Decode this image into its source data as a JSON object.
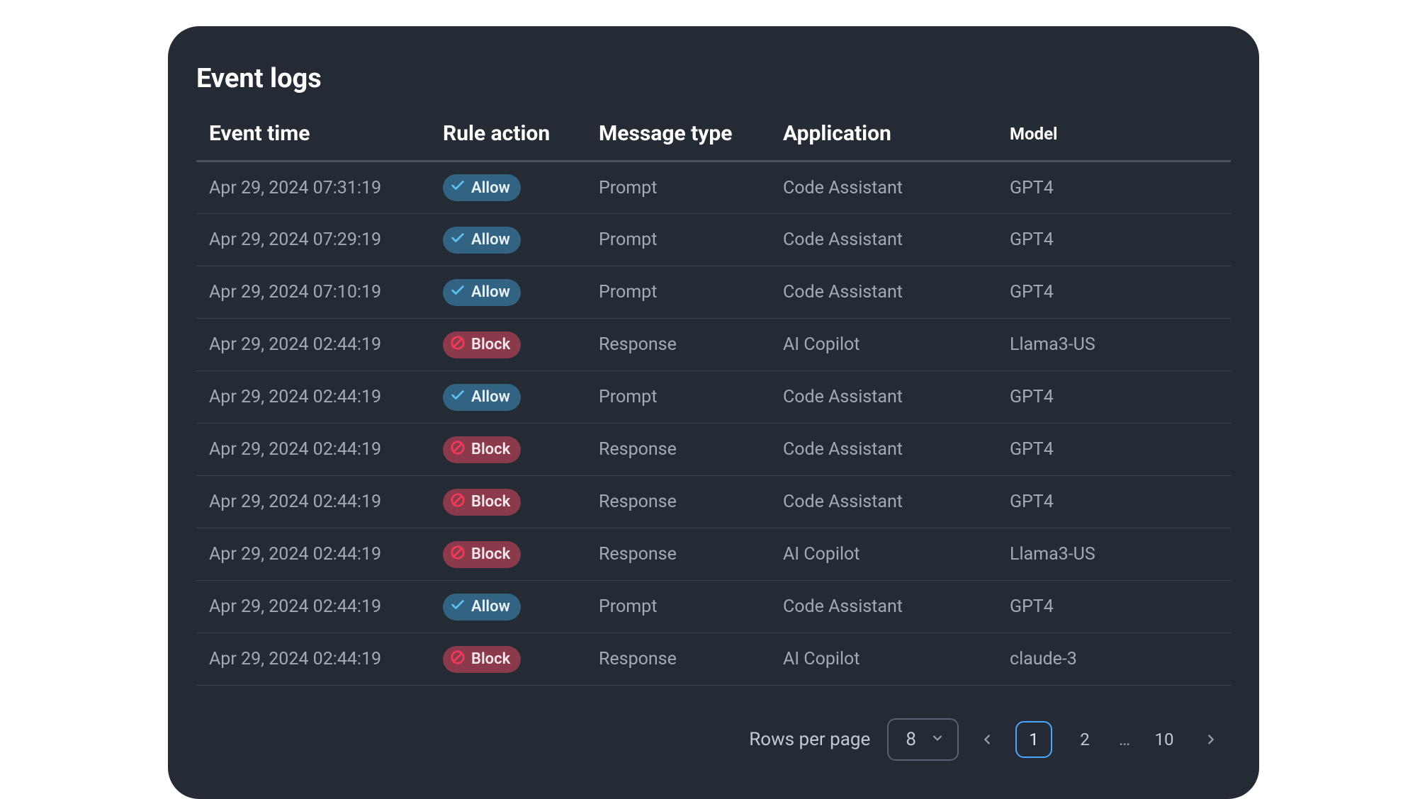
{
  "title": "Event logs",
  "columns": {
    "time": "Event time",
    "action": "Rule action",
    "msgtype": "Message type",
    "app": "Application",
    "model": "Model"
  },
  "badge_labels": {
    "allow": "Allow",
    "block": "Block"
  },
  "rows": [
    {
      "time": "Apr 29, 2024 07:31:19",
      "action": "allow",
      "msgtype": "Prompt",
      "app": "Code Assistant",
      "model": "GPT4"
    },
    {
      "time": "Apr 29, 2024 07:29:19",
      "action": "allow",
      "msgtype": "Prompt",
      "app": "Code Assistant",
      "model": "GPT4"
    },
    {
      "time": "Apr 29, 2024 07:10:19",
      "action": "allow",
      "msgtype": "Prompt",
      "app": "Code Assistant",
      "model": "GPT4"
    },
    {
      "time": "Apr 29, 2024 02:44:19",
      "action": "block",
      "msgtype": "Response",
      "app": "AI Copilot",
      "model": "Llama3-US"
    },
    {
      "time": "Apr 29, 2024 02:44:19",
      "action": "allow",
      "msgtype": "Prompt",
      "app": "Code Assistant",
      "model": "GPT4"
    },
    {
      "time": "Apr 29, 2024 02:44:19",
      "action": "block",
      "msgtype": "Response",
      "app": "Code Assistant",
      "model": "GPT4"
    },
    {
      "time": "Apr 29, 2024 02:44:19",
      "action": "block",
      "msgtype": "Response",
      "app": "Code Assistant",
      "model": "GPT4"
    },
    {
      "time": "Apr 29, 2024 02:44:19",
      "action": "block",
      "msgtype": "Response",
      "app": "AI Copilot",
      "model": "Llama3-US"
    },
    {
      "time": "Apr 29, 2024 02:44:19",
      "action": "allow",
      "msgtype": "Prompt",
      "app": "Code Assistant",
      "model": "GPT4"
    },
    {
      "time": "Apr 29, 2024 02:44:19",
      "action": "block",
      "msgtype": "Response",
      "app": "AI Copilot",
      "model": "claude-3"
    }
  ],
  "pager": {
    "rows_per_page_label": "Rows per page",
    "rows_per_page_value": "8",
    "current_page": "1",
    "pages": [
      "1",
      "2"
    ],
    "ellipsis": "…",
    "last_page": "10"
  }
}
